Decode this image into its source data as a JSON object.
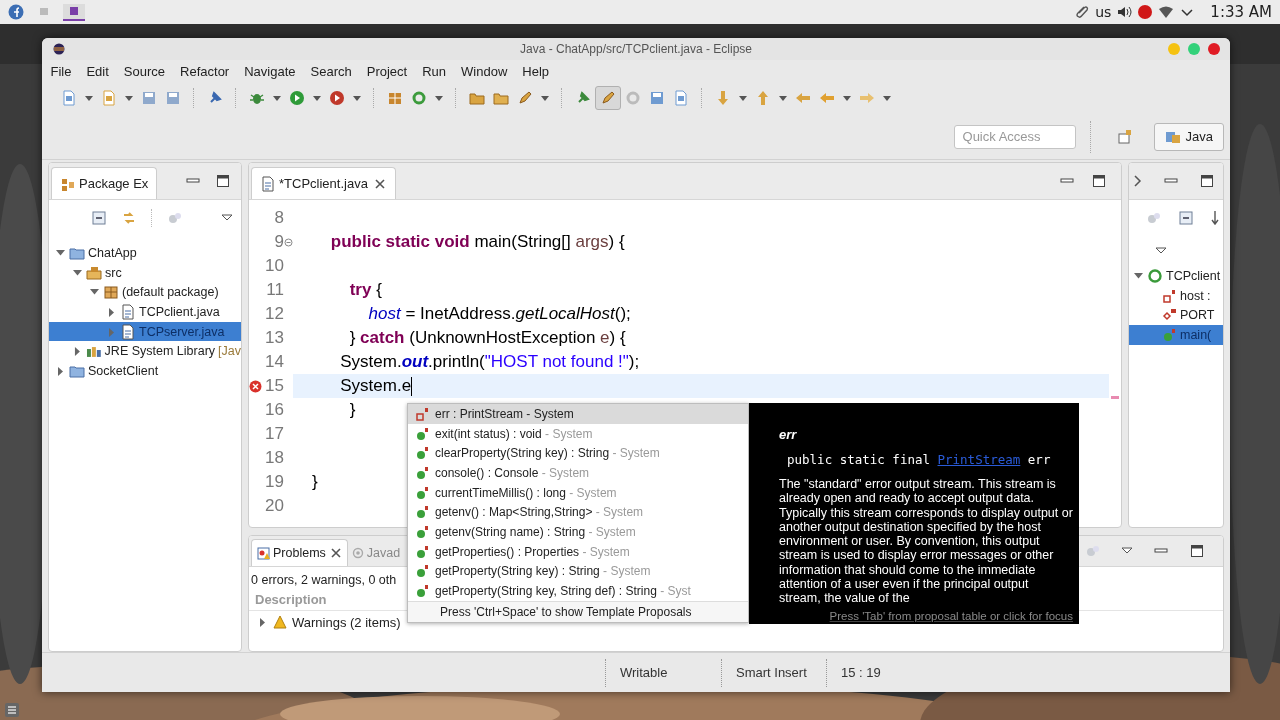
{
  "top_panel": {
    "taskbar": [
      {
        "selected": false
      },
      {
        "selected": true
      }
    ],
    "keyboard_layout": "us",
    "clock": "1:33 AM"
  },
  "window": {
    "title": "Java - ChatApp/src/TCPclient.java - Eclipse"
  },
  "menu": [
    "File",
    "Edit",
    "Source",
    "Refactor",
    "Navigate",
    "Search",
    "Project",
    "Run",
    "Window",
    "Help"
  ],
  "toolbar": {
    "highlight_toggle": {
      "on": true
    }
  },
  "quick_access": {
    "placeholder": "Quick Access"
  },
  "perspectives": [
    {
      "label": "Java",
      "selected": true
    }
  ],
  "package_explorer": {
    "tab": {
      "label": "Package Ex",
      "selected": true
    },
    "tree": [
      {
        "kind": "project",
        "label": "ChatApp",
        "expanded": true,
        "selected": false,
        "children": [
          {
            "kind": "source-folder",
            "label": "src",
            "expanded": true,
            "selected": false,
            "children": [
              {
                "kind": "package",
                "label": "(default package)",
                "expanded": true,
                "selected": false,
                "children": [
                  {
                    "kind": "java-file",
                    "label": "TCPclient.java",
                    "expanded": false,
                    "selected": false
                  },
                  {
                    "kind": "java-file",
                    "label": "TCPserver.java",
                    "expanded": false,
                    "selected": true
                  }
                ]
              }
            ]
          },
          {
            "kind": "library",
            "label": "JRE System Library",
            "decoration": "[Jav",
            "expanded": false,
            "selected": false
          }
        ]
      },
      {
        "kind": "project",
        "label": "SocketClient",
        "expanded": false,
        "selected": false
      }
    ]
  },
  "editor": {
    "tabs": [
      {
        "label": "*TCPclient.java",
        "selected": true
      }
    ],
    "lines": [
      {
        "number": "8",
        "current": false,
        "error": false,
        "fold": false
      },
      {
        "number": "9",
        "current": false,
        "error": false,
        "fold": true,
        "tokens": [
          {
            "kind": "keyword",
            "text": "\t\tpublic static void"
          },
          {
            "kind": "plain",
            "text": " main(String[] "
          },
          {
            "kind": "local",
            "text": "args"
          },
          {
            "kind": "plain",
            "text": ") {"
          }
        ]
      },
      {
        "number": "10",
        "current": false,
        "error": false,
        "fold": false
      },
      {
        "number": "11",
        "current": false,
        "error": false,
        "fold": false,
        "tokens": [
          {
            "kind": "keyword",
            "text": "\t\t\ttry"
          },
          {
            "kind": "plain",
            "text": " {"
          }
        ]
      },
      {
        "number": "12",
        "current": false,
        "error": false,
        "fold": false,
        "tokens": [
          {
            "kind": "field",
            "text": "\t\t\t\thost"
          },
          {
            "kind": "plain",
            "text": " = InetAddress."
          },
          {
            "kind": "static-method",
            "text": "getLocalHost"
          },
          {
            "kind": "plain",
            "text": "();"
          }
        ]
      },
      {
        "number": "13",
        "current": false,
        "error": false,
        "fold": false,
        "tokens": [
          {
            "kind": "plain",
            "text": "\t\t\t} "
          },
          {
            "kind": "keyword",
            "text": "catch"
          },
          {
            "kind": "plain",
            "text": " (UnknownHostException "
          },
          {
            "kind": "local",
            "text": "e"
          },
          {
            "kind": "plain",
            "text": ") {"
          }
        ]
      },
      {
        "number": "14",
        "current": false,
        "error": false,
        "fold": false,
        "tokens": [
          {
            "kind": "plain",
            "text": "\t\t  System."
          },
          {
            "kind": "static-field",
            "text": "out"
          },
          {
            "kind": "plain",
            "text": ".println("
          },
          {
            "kind": "string",
            "text": "\"HOST not found !\""
          },
          {
            "kind": "plain",
            "text": ");"
          }
        ]
      },
      {
        "number": "15",
        "current": true,
        "error": true,
        "fold": false,
        "tokens": [
          {
            "kind": "plain",
            "text": "\t\t  System.e"
          }
        ]
      },
      {
        "number": "16",
        "current": false,
        "error": false,
        "fold": false,
        "tokens": [
          {
            "kind": "plain",
            "text": "\t\t\t}"
          }
        ]
      },
      {
        "number": "17",
        "current": false,
        "error": false,
        "fold": false
      },
      {
        "number": "18",
        "current": false,
        "error": false,
        "fold": false
      },
      {
        "number": "19",
        "current": false,
        "error": false,
        "fold": false,
        "tokens": [
          {
            "kind": "plain",
            "text": "\t}"
          }
        ]
      },
      {
        "number": "20",
        "current": false,
        "error": false,
        "fold": false
      }
    ]
  },
  "outline": {
    "tree": [
      {
        "kind": "class",
        "label": "TCPclient",
        "expanded": true,
        "selected": false,
        "children": [
          {
            "kind": "field",
            "label": "host :",
            "selected": false
          },
          {
            "kind": "constant",
            "label": "PORT",
            "selected": false
          },
          {
            "kind": "method",
            "label": "main(",
            "selected": true
          }
        ]
      }
    ]
  },
  "problems": {
    "tabs": [
      {
        "kind": "problems",
        "label": "Problems",
        "selected": true
      },
      {
        "kind": "javadoc",
        "label": "Javad",
        "selected": false
      }
    ],
    "summary": "0 errors, 2 warnings, 0 oth",
    "columns": [
      "Description"
    ],
    "rows": [
      {
        "label": "Warnings (2 items)",
        "expanded": false
      }
    ]
  },
  "status_bar": [
    "Writable",
    "Smart Insert",
    "15 : 19"
  ],
  "completion": {
    "items": [
      {
        "kind": "field",
        "name": "err : PrintStream",
        "owner": "- System",
        "selected": true
      },
      {
        "kind": "method",
        "name": "exit(int status) : void",
        "owner": "- System",
        "selected": false
      },
      {
        "kind": "method",
        "name": "clearProperty(String key) : String",
        "owner": "- System",
        "selected": false
      },
      {
        "kind": "method",
        "name": "console() : Console",
        "owner": "- System",
        "selected": false
      },
      {
        "kind": "method",
        "name": "currentTimeMillis() : long",
        "owner": "- System",
        "selected": false
      },
      {
        "kind": "method",
        "name": "getenv() : Map<String,String>",
        "owner": "- System",
        "selected": false
      },
      {
        "kind": "method",
        "name": "getenv(String name) : String",
        "owner": "- System",
        "selected": false
      },
      {
        "kind": "method",
        "name": "getProperties() : Properties",
        "owner": "- System",
        "selected": false
      },
      {
        "kind": "method",
        "name": "getProperty(String key) : String",
        "owner": "- System",
        "selected": false
      },
      {
        "kind": "method",
        "name": "getProperty(String key, String def) : String",
        "owner": "- Syst",
        "selected": false
      }
    ],
    "footer": "Press 'Ctrl+Space' to show Template Proposals"
  },
  "doc": {
    "title": "err",
    "signature_start": "public static final",
    "signature_link": "PrintStream",
    "signature_end": "err",
    "body": "The \"standard\" error output stream. This stream is already open and ready to accept output data. Typically this stream corresponds to display output or another output destination specified by the host environment or user. By convention, this output stream is used to display error messages or other information that should come to the immediate attention of a user even if the principal output stream, the value of the",
    "footer": "Press 'Tab' from proposal table or click for focus"
  }
}
